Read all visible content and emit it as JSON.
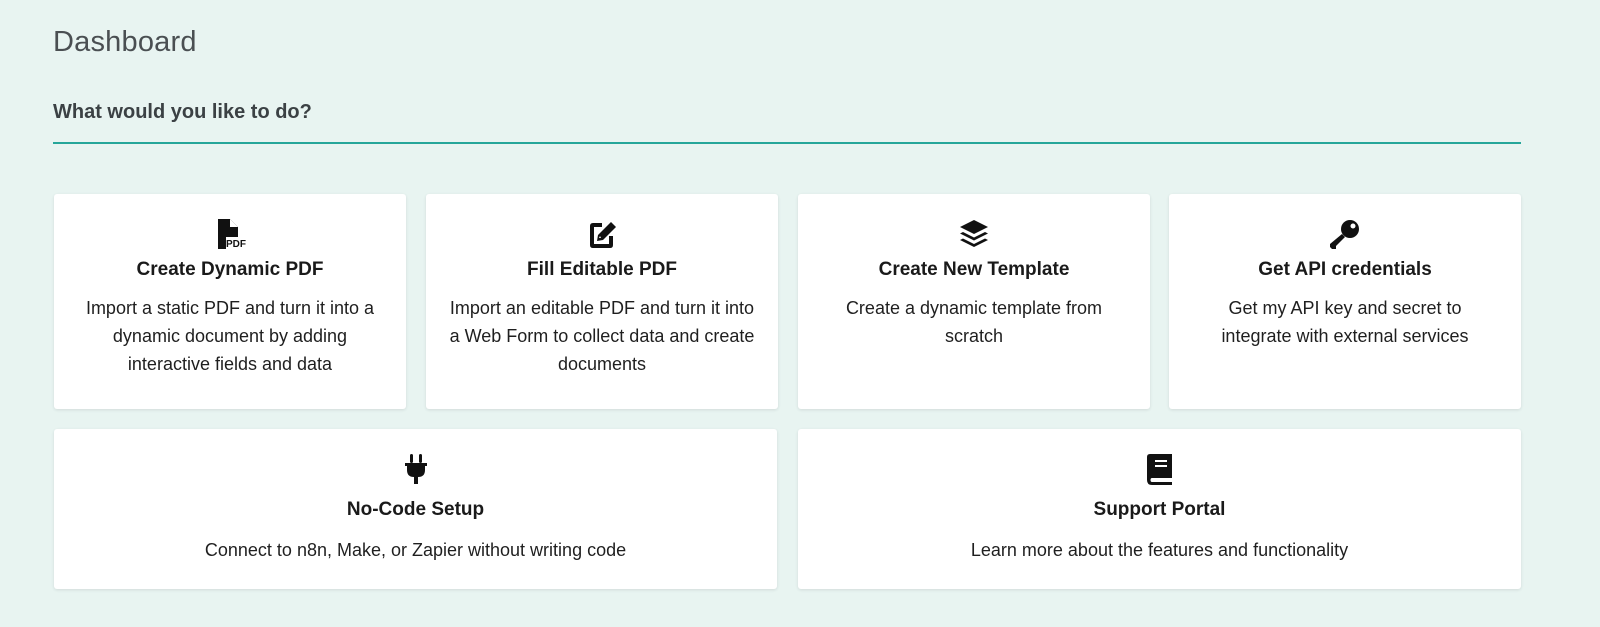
{
  "page": {
    "title": "Dashboard",
    "section_heading": "What would you like to do?",
    "accent_color": "#26a69a",
    "background_color": "#e8f4f1"
  },
  "cards": [
    {
      "icon": "file-pdf-icon",
      "title": "Create Dynamic PDF",
      "description": "Import a static PDF and turn it into a dynamic document by adding interactive fields and data"
    },
    {
      "icon": "edit-icon",
      "title": "Fill Editable PDF",
      "description": "Import an editable PDF and turn it into a Web Form to collect data and create documents"
    },
    {
      "icon": "layers-icon",
      "title": "Create New Template",
      "description": "Create a dynamic template from scratch"
    },
    {
      "icon": "key-icon",
      "title": "Get API credentials",
      "description": "Get my API key and secret to integrate with external services"
    },
    {
      "icon": "plug-icon",
      "title": "No-Code Setup",
      "description": "Connect to n8n, Make, or Zapier without writing code"
    },
    {
      "icon": "book-icon",
      "title": "Support Portal",
      "description": "Learn more about the features and functionality"
    }
  ]
}
